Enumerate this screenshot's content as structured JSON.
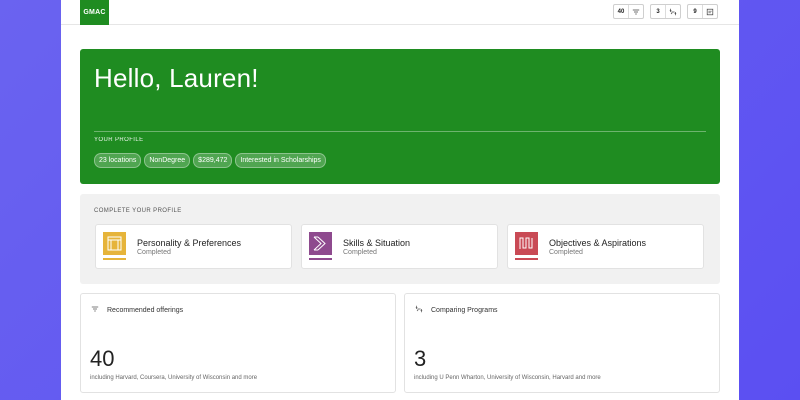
{
  "topbar": {
    "logo": "GMAC",
    "pills": [
      {
        "count": "40",
        "icon": "filter-icon"
      },
      {
        "count": "3",
        "icon": "compare-icon"
      },
      {
        "count": "9",
        "icon": "list-icon"
      }
    ]
  },
  "hero": {
    "greeting": "Hello, Lauren!",
    "profile_label": "YOUR PROFILE",
    "tags": [
      "23 locations",
      "NonDegree",
      "$289,472",
      "Interested in Scholarships"
    ]
  },
  "complete": {
    "label": "COMPLETE YOUR PROFILE",
    "cards": [
      {
        "title": "Personality & Preferences",
        "status": "Completed",
        "icon": "personality-icon",
        "color": "#e6b43a"
      },
      {
        "title": "Skills & Situation",
        "status": "Completed",
        "icon": "skills-icon",
        "color": "#8e4a8e"
      },
      {
        "title": "Objectives & Aspirations",
        "status": "Completed",
        "icon": "objectives-icon",
        "color": "#c94a55"
      }
    ]
  },
  "stats": [
    {
      "title": "Recommended offerings",
      "icon": "filter-icon",
      "value": "40",
      "subtitle": "including Harvard, Coursera, University of Wisconsin and more"
    },
    {
      "title": "Comparing Programs",
      "icon": "compare-icon",
      "value": "3",
      "subtitle": "including U Penn Wharton, University of Wisconsin, Harvard and more"
    }
  ],
  "colors": {
    "brand": "#1f8c21",
    "background": "#5b4ff2"
  }
}
